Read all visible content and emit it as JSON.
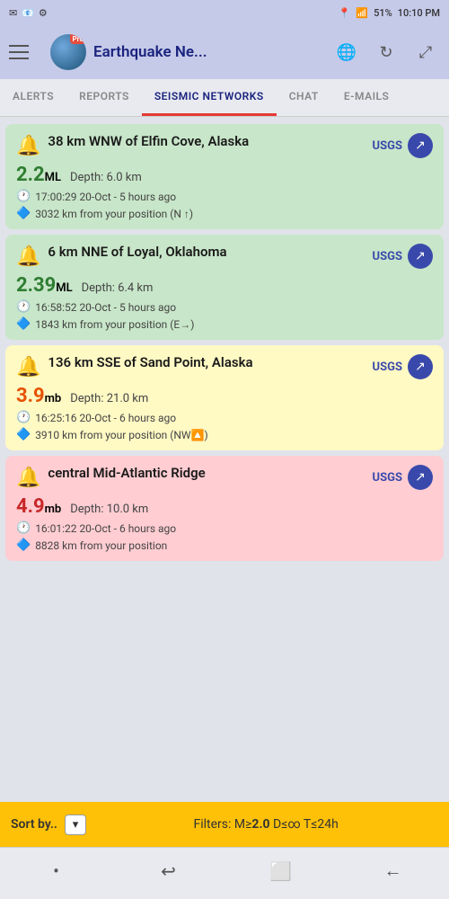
{
  "statusBar": {
    "leftIcons": [
      "✉",
      "📧",
      "⚙"
    ],
    "battery": "51%",
    "time": "10:10 PM",
    "signal": "📶"
  },
  "header": {
    "title": "Earthquake Ne...",
    "menuLabel": "menu",
    "globeAlt": "globe",
    "refreshAlt": "refresh",
    "expandAlt": "expand"
  },
  "tabs": [
    {
      "id": "alerts",
      "label": "ALERTS"
    },
    {
      "id": "reports",
      "label": "REPORTS"
    },
    {
      "id": "seismic",
      "label": "SEISMIC NETWORKS",
      "active": true
    },
    {
      "id": "chat",
      "label": "CHAT"
    },
    {
      "id": "emails",
      "label": "E-MAILS"
    }
  ],
  "earthquakes": [
    {
      "id": 1,
      "color": "green",
      "location": "38 km WNW of Elfin Cove, Alaska",
      "source": "USGS",
      "magnitude": "2.2",
      "magUnit": "ML",
      "magColor": "green-mag",
      "depth": "Depth: 6.0 km",
      "time": "17:00:29 20-Oct - 5 hours ago",
      "distance": "3032 km from your position (N ↑)"
    },
    {
      "id": 2,
      "color": "green",
      "location": "6 km NNE of Loyal, Oklahoma",
      "source": "USGS",
      "magnitude": "2.39",
      "magUnit": "ML",
      "magColor": "green-mag",
      "depth": "Depth: 6.4 km",
      "time": "16:58:52 20-Oct - 5 hours ago",
      "distance": "1843 km from your position (E→)"
    },
    {
      "id": 3,
      "color": "yellow",
      "location": "136 km SSE of Sand Point, Alaska",
      "source": "USGS",
      "magnitude": "3.9",
      "magUnit": "mb",
      "magColor": "orange-mag",
      "depth": "Depth: 21.0 km",
      "time": "16:25:16 20-Oct - 6 hours ago",
      "distance": "3910 km from your position (NW🔼)"
    },
    {
      "id": 4,
      "color": "pink",
      "location": "central Mid-Atlantic Ridge",
      "source": "USGS",
      "magnitude": "4.9",
      "magUnit": "mb",
      "magColor": "red-mag",
      "depth": "Depth: 10.0 km",
      "time": "16:01:22 20-Oct - 6 hours ago",
      "distance": "8828 km from your position"
    }
  ],
  "bottomBar": {
    "sortLabel": "Sort by..",
    "filterText": "Filters: M≥",
    "filterM": "2.0",
    "filterD": " D≤∞ T≤24h"
  },
  "bottomNav": [
    {
      "id": "dot",
      "icon": "•"
    },
    {
      "id": "back-nav",
      "icon": "⤶"
    },
    {
      "id": "home-nav",
      "icon": "⬜"
    },
    {
      "id": "back",
      "icon": "←"
    }
  ]
}
